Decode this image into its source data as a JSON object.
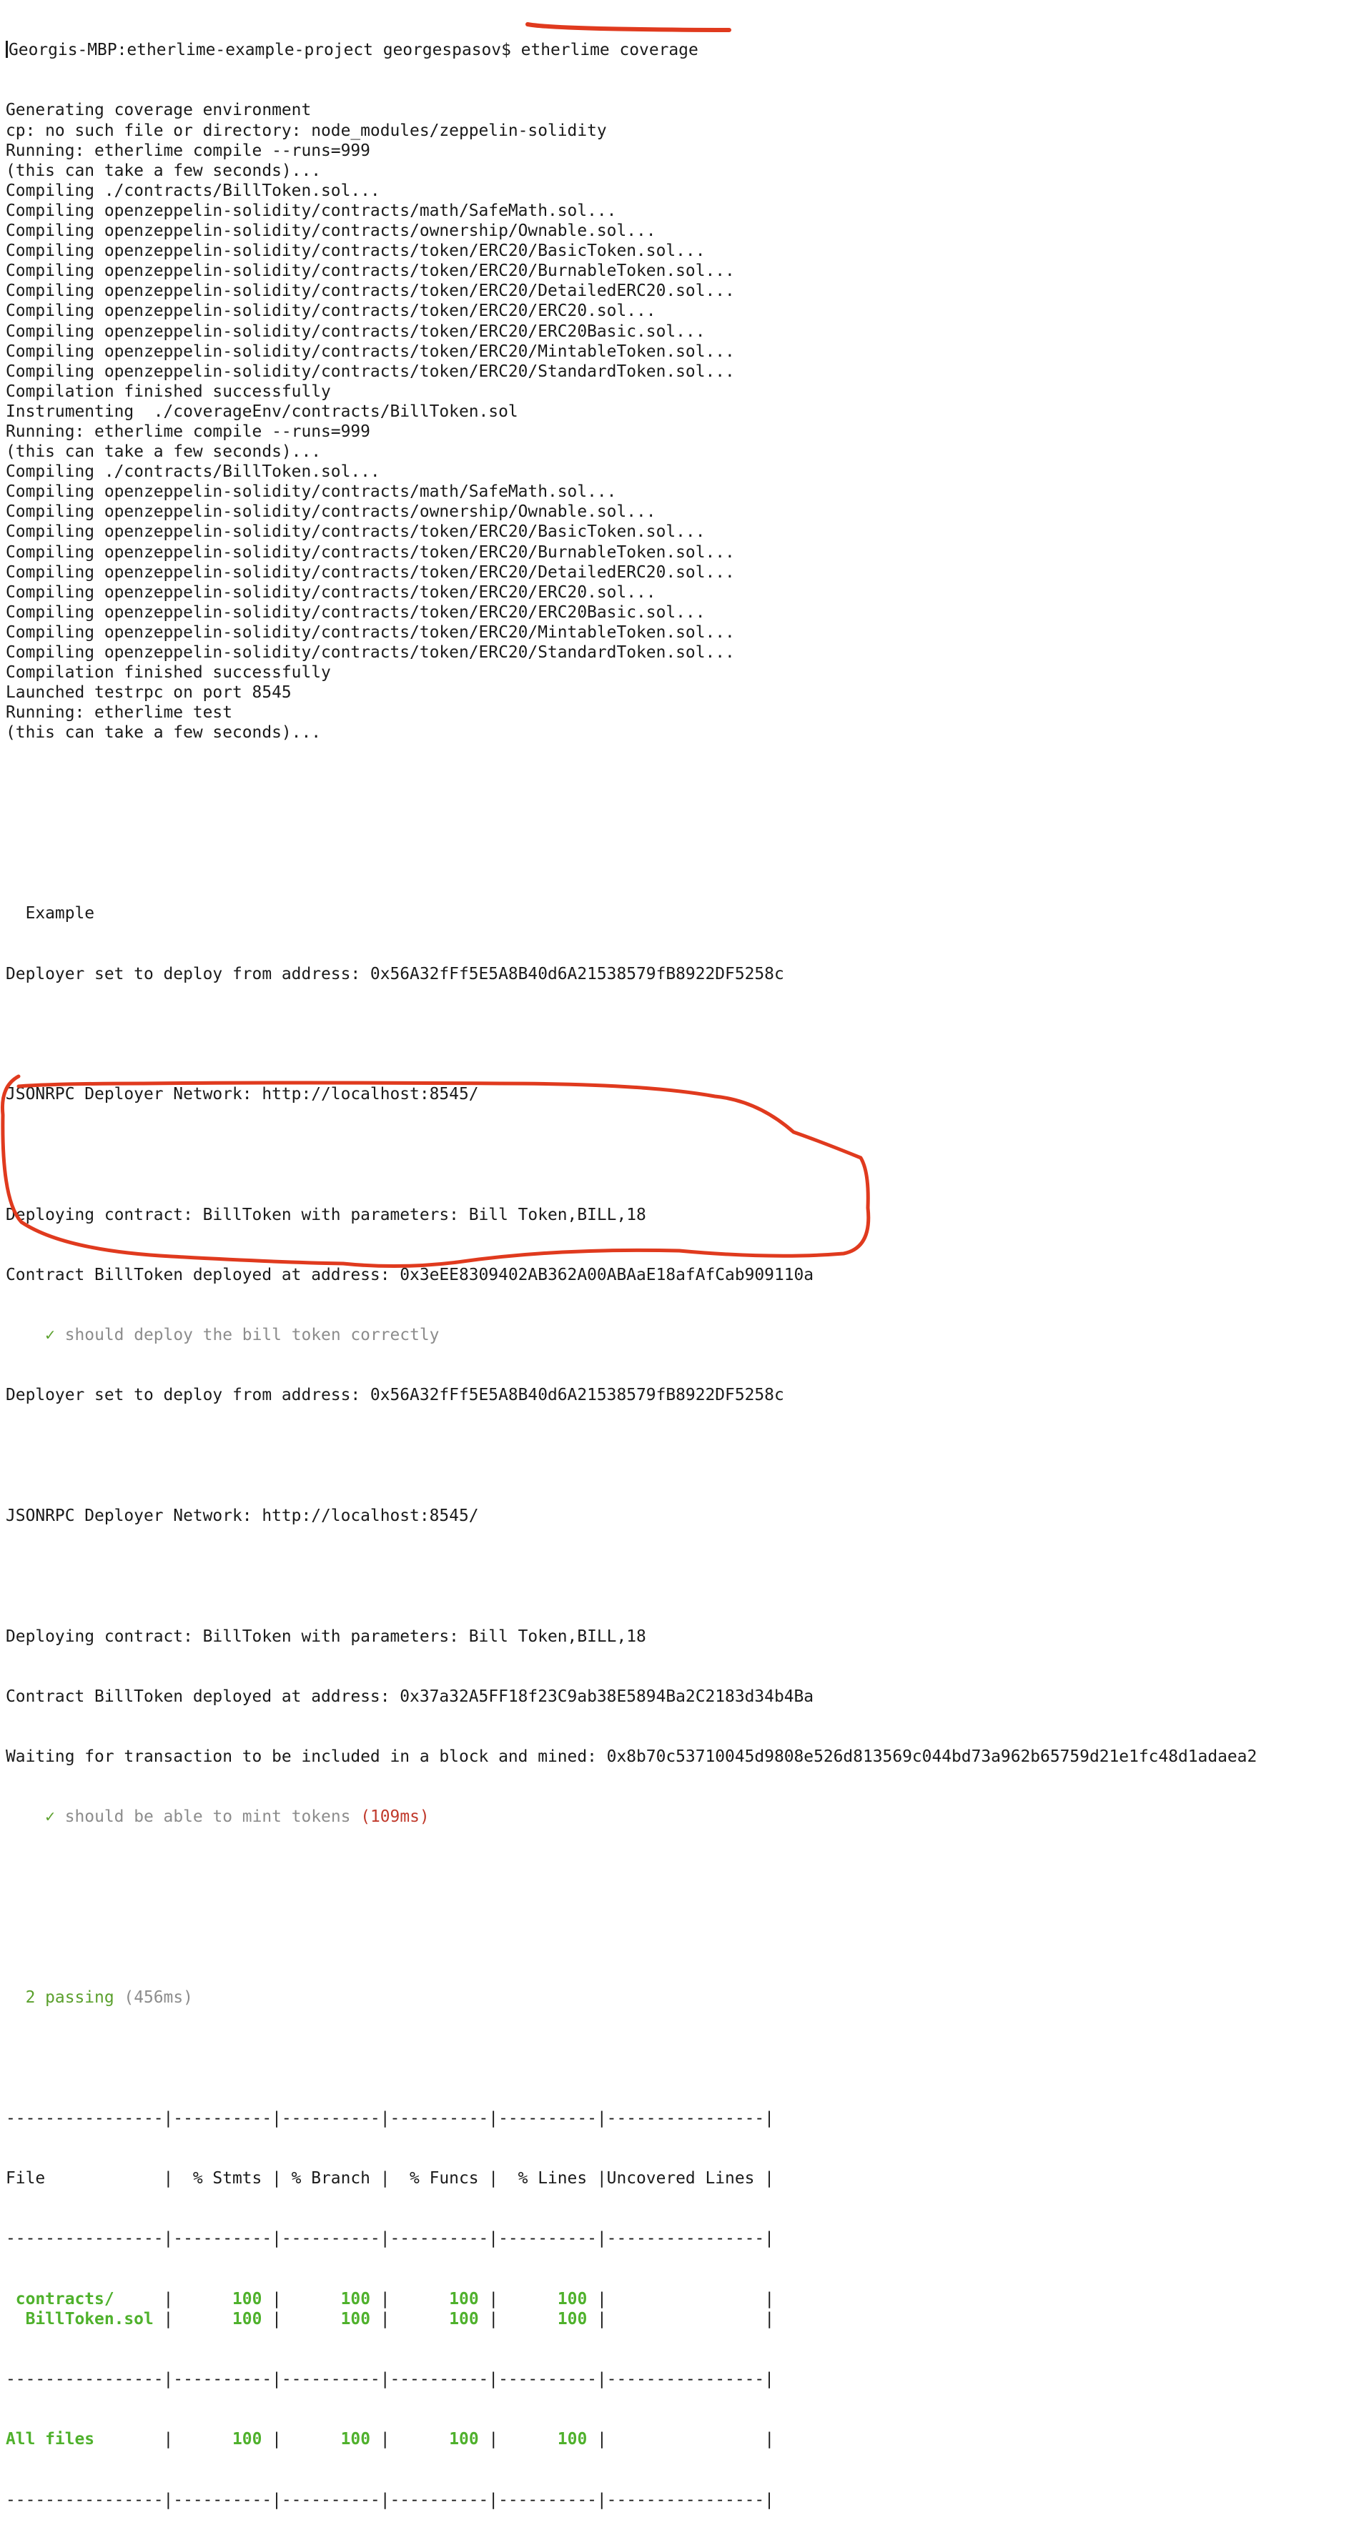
{
  "prompt": {
    "host": "Georgis-MBP:etherlime-example-project georgespasov$",
    "command": "etherlime coverage"
  },
  "log_lines_1": [
    "Generating coverage environment",
    "cp: no such file or directory: node_modules/zeppelin-solidity",
    "Running: etherlime compile --runs=999",
    "(this can take a few seconds)...",
    "Compiling ./contracts/BillToken.sol...",
    "Compiling openzeppelin-solidity/contracts/math/SafeMath.sol...",
    "Compiling openzeppelin-solidity/contracts/ownership/Ownable.sol...",
    "Compiling openzeppelin-solidity/contracts/token/ERC20/BasicToken.sol...",
    "Compiling openzeppelin-solidity/contracts/token/ERC20/BurnableToken.sol...",
    "Compiling openzeppelin-solidity/contracts/token/ERC20/DetailedERC20.sol...",
    "Compiling openzeppelin-solidity/contracts/token/ERC20/ERC20.sol...",
    "Compiling openzeppelin-solidity/contracts/token/ERC20/ERC20Basic.sol...",
    "Compiling openzeppelin-solidity/contracts/token/ERC20/MintableToken.sol...",
    "Compiling openzeppelin-solidity/contracts/token/ERC20/StandardToken.sol...",
    "Compilation finished successfully",
    "Instrumenting  ./coverageEnv/contracts/BillToken.sol",
    "Running: etherlime compile --runs=999",
    "(this can take a few seconds)...",
    "Compiling ./contracts/BillToken.sol...",
    "Compiling openzeppelin-solidity/contracts/math/SafeMath.sol...",
    "Compiling openzeppelin-solidity/contracts/ownership/Ownable.sol...",
    "Compiling openzeppelin-solidity/contracts/token/ERC20/BasicToken.sol...",
    "Compiling openzeppelin-solidity/contracts/token/ERC20/BurnableToken.sol...",
    "Compiling openzeppelin-solidity/contracts/token/ERC20/DetailedERC20.sol...",
    "Compiling openzeppelin-solidity/contracts/token/ERC20/ERC20.sol...",
    "Compiling openzeppelin-solidity/contracts/token/ERC20/ERC20Basic.sol...",
    "Compiling openzeppelin-solidity/contracts/token/ERC20/MintableToken.sol...",
    "Compiling openzeppelin-solidity/contracts/token/ERC20/StandardToken.sol...",
    "Compilation finished successfully",
    "Launched testrpc on port 8545",
    "Running: etherlime test",
    "(this can take a few seconds)..."
  ],
  "test_suite": {
    "name": "  Example",
    "deployer_line_1": "Deployer set to deploy from address: 0x56A32fFf5E5A8B40d6A21538579fB8922DF5258c",
    "network_line_1": "JSONRPC Deployer Network: http://localhost:8545/",
    "deploying_line_1": "Deploying contract: BillToken with parameters: Bill Token,BILL,18",
    "deployed_line_1": "Contract BillToken deployed at address: 0x3eEE8309402AB362A00ABAaE18afAfCab909110a",
    "test_1": {
      "check": "✓",
      "label": "should deploy the bill token correctly"
    },
    "deployer_line_2": "Deployer set to deploy from address: 0x56A32fFf5E5A8B40d6A21538579fB8922DF5258c",
    "network_line_2": "JSONRPC Deployer Network: http://localhost:8545/",
    "deploying_line_2": "Deploying contract: BillToken with parameters: Bill Token,BILL,18",
    "deployed_line_2": "Contract BillToken deployed at address: 0x37a32A5FF18f23C9ab38E5894Ba2C2183d34b4Ba",
    "waiting_line": "Waiting for transaction to be included in a block and mined: 0x8b70c53710045d9808e526d813569c044bd73a962b65759d21e1fc48d1adaea2",
    "test_2": {
      "check": "✓",
      "label": "should be able to mint tokens",
      "duration": "(109ms)"
    },
    "passing": "2 passing",
    "passing_duration": "(456ms)"
  },
  "coverage_table": {
    "separator": "----------------|----------|----------|----------|----------|----------------|",
    "header": "File            |  % Stmts | % Branch |  % Funcs |  % Lines |Uncovered Lines |",
    "rows": [
      {
        "file": " contracts/     ",
        "stmts": "100",
        "branch": "100",
        "funcs": "100",
        "lines": "100",
        "uncovered": ""
      },
      {
        "file": "  BillToken.sol ",
        "stmts": "100",
        "branch": "100",
        "funcs": "100",
        "lines": "100",
        "uncovered": ""
      }
    ],
    "total": {
      "file": "All files       ",
      "stmts": "100",
      "branch": "100",
      "funcs": "100",
      "lines": "100",
      "uncovered": ""
    }
  },
  "colors": {
    "text": "#1a1a1a",
    "dim": "#8c8c8c",
    "pass_green": "#5aa02c",
    "coverage_green": "#4fb12c",
    "slow_red": "#c0392b",
    "annotation_red": "#e03a1e"
  }
}
